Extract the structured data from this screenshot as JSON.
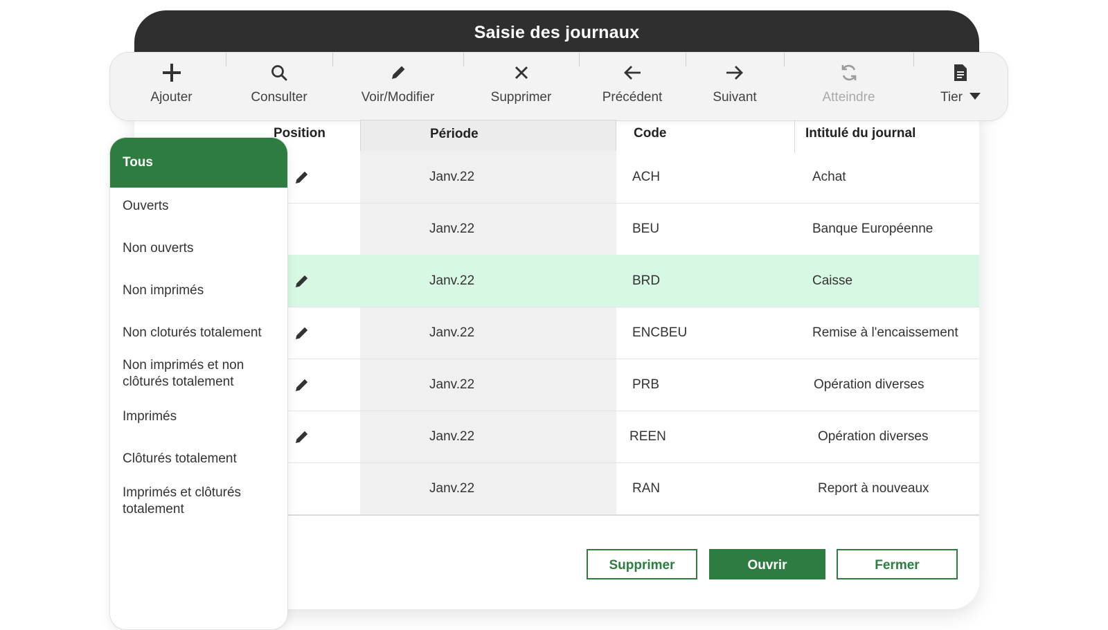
{
  "window": {
    "title": "Saisie des journaux"
  },
  "toolbar": {
    "items": [
      {
        "label": "Ajouter",
        "icon": "plus-icon",
        "enabled": true
      },
      {
        "label": "Consulter",
        "icon": "search-icon",
        "enabled": true
      },
      {
        "label": "Voir/Modifier",
        "icon": "pencil-icon",
        "enabled": true
      },
      {
        "label": "Supprimer",
        "icon": "close-icon",
        "enabled": true
      },
      {
        "label": "Précédent",
        "icon": "arrow-left-icon",
        "enabled": true
      },
      {
        "label": "Suivant",
        "icon": "arrow-right-icon",
        "enabled": true
      },
      {
        "label": "Atteindre",
        "icon": "refresh-icon",
        "enabled": false
      },
      {
        "label": "Tier",
        "icon": "document-icon",
        "enabled": true
      }
    ]
  },
  "filters": {
    "items": [
      {
        "label": "Tous",
        "active": true
      },
      {
        "label": "Ouverts"
      },
      {
        "label": "Non ouverts"
      },
      {
        "label": "Non imprimés"
      },
      {
        "label": "Non cloturés totalement"
      },
      {
        "label": "Non imprimés et non clôturés totalement"
      },
      {
        "label": "Imprimés"
      },
      {
        "label": "Clôturés totalement"
      },
      {
        "label": "Imprimés et clôturés totalement"
      }
    ]
  },
  "table": {
    "columns": [
      "Position",
      "Période",
      "Code",
      "Intitulé du journal"
    ],
    "rows": [
      {
        "edit": true,
        "periode": "Janv.22",
        "code": "ACH",
        "intitule": "Achat"
      },
      {
        "edit": false,
        "periode": "Janv.22",
        "code": "BEU",
        "intitule": "Banque Européenne"
      },
      {
        "edit": true,
        "periode": "Janv.22",
        "code": "BRD",
        "intitule": "Caisse",
        "selected": true
      },
      {
        "edit": true,
        "periode": "Janv.22",
        "code": "ENCBEU",
        "intitule": "Remise à l'encaissement"
      },
      {
        "edit": true,
        "periode": "Janv.22",
        "code": "PRB",
        "intitule": "Opération diverses"
      },
      {
        "edit": true,
        "periode": "Janv.22",
        "code": "REEN",
        "intitule": "Opération diverses"
      },
      {
        "edit": false,
        "periode": "Janv.22",
        "code": "RAN",
        "intitule": "Report à nouveaux"
      }
    ]
  },
  "footer": {
    "delete_label": "Supprimer",
    "open_label": "Ouvrir",
    "close_label": "Fermer"
  },
  "colors": {
    "accent": "#2c7d3f",
    "selected_row": "#d7f8e3",
    "titlebar": "#2f2f2f"
  }
}
